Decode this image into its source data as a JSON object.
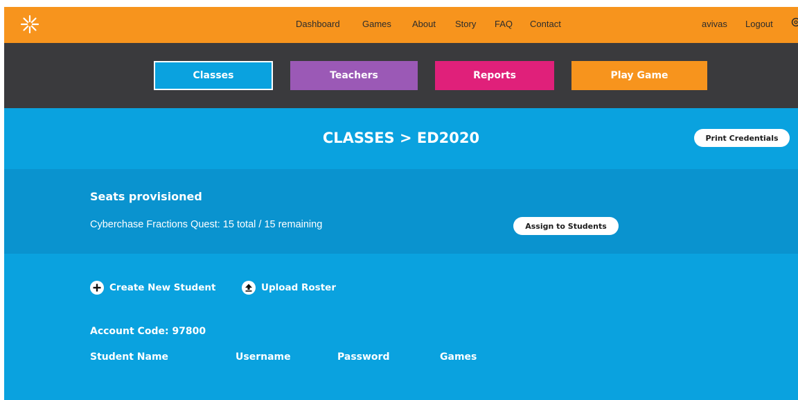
{
  "colors": {
    "topbar": "#f7941d",
    "tabbar": "#3a3a3d",
    "primary_blue": "#0aa2df",
    "seats_blue": "#0a93cf",
    "teachers_purple": "#9b59b6",
    "reports_pink": "#e0207a",
    "play_orange": "#f7941d"
  },
  "header": {
    "logo_icon": "asterisk-logo-icon",
    "nav": [
      "Dashboard",
      "Games",
      "About",
      "Story",
      "FAQ",
      "Contact"
    ],
    "user": "avivas",
    "logout": "Logout",
    "edge_icon": "cut-off-icon"
  },
  "tabs": {
    "classes": "Classes",
    "teachers": "Teachers",
    "reports": "Reports",
    "play_game": "Play Game"
  },
  "page": {
    "title": "CLASSES > ED2020",
    "print_credentials": "Print Credentials"
  },
  "seats": {
    "heading": "Seats provisioned",
    "line": "Cyberchase Fractions Quest: 15 total / 15 remaining",
    "assign_button": "Assign to Students"
  },
  "actions": {
    "create_student": "Create New Student",
    "create_icon": "plus-circle-icon",
    "upload_roster": "Upload Roster",
    "upload_icon": "upload-circle-icon"
  },
  "account": {
    "label": "Account Code:",
    "code": "97800"
  },
  "table": {
    "columns": [
      "Student Name",
      "Username",
      "Password",
      "Games"
    ]
  }
}
